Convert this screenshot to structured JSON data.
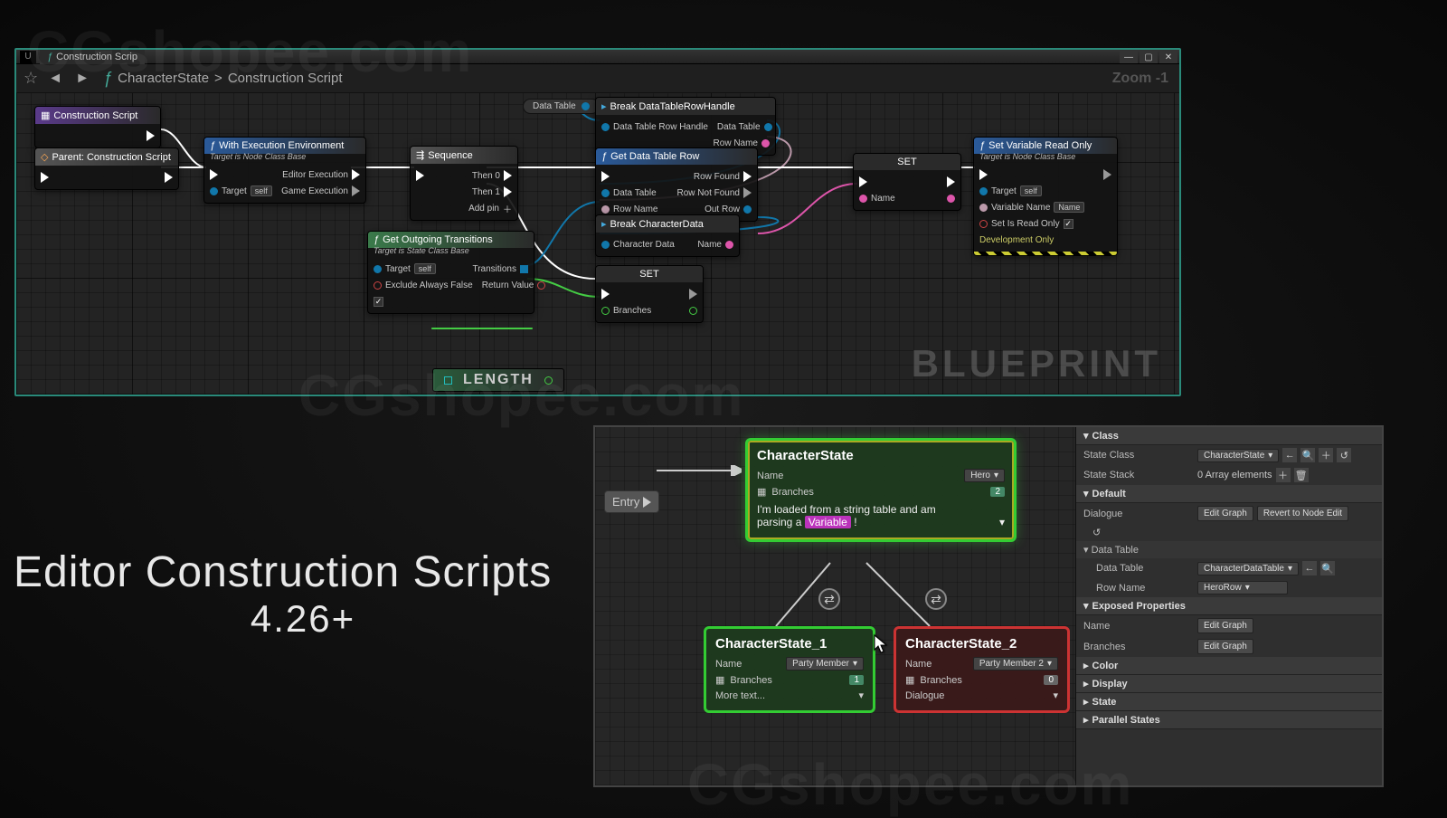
{
  "watermarks": [
    "CGshopee.com",
    "CGshopee.com",
    "CGshopee.com"
  ],
  "bp": {
    "tab_title": "Construction Scrip",
    "breadcrumb_graph": "CharacterState",
    "breadcrumb_sep": ">",
    "breadcrumb_func": "Construction Script",
    "zoom": "Zoom -1",
    "label": "BLUEPRINT",
    "nodes": {
      "cs_entry": "Construction Script",
      "parent": "Parent: Construction Script",
      "wee_title": "With Execution Environment",
      "wee_sub": "Target is Node Class Base",
      "wee_p1": "Editor Execution",
      "wee_p2": "Target",
      "wee_self": "self",
      "wee_p3": "Game Execution",
      "seq_title": "Sequence",
      "seq_then0": "Then 0",
      "seq_then1": "Then 1",
      "seq_add": "Add pin",
      "got_title": "Get Outgoing Transitions",
      "got_sub": "Target is State Class Base",
      "got_target": "Target",
      "got_self": "self",
      "got_exclude": "Exclude Always False",
      "got_trans": "Transitions",
      "got_ret": "Return Value",
      "length": "LENGTH",
      "dt_pill": "Data Table",
      "break_h": "Break DataTableRowHandle",
      "break_h_p1": "Data Table Row Handle",
      "break_h_p2": "Data Table",
      "break_h_p3": "Row Name",
      "gdt_title": "Get Data Table Row",
      "gdt_p1": "Data Table",
      "gdt_p2": "Row Name",
      "gdt_rf": "Row Found",
      "gdt_rnf": "Row Not Found",
      "gdt_out": "Out Row",
      "bcd_title": "Break CharacterData",
      "bcd_p1": "Character Data",
      "bcd_name": "Name",
      "set1": "SET",
      "set1_branches": "Branches",
      "set2": "SET",
      "set2_name": "Name",
      "svr_title": "Set Variable Read Only",
      "svr_sub": "Target is Node Class Base",
      "svr_target": "Target",
      "svr_self": "self",
      "svr_var": "Variable Name",
      "svr_name": "Name",
      "svr_ro": "Set Is Read Only",
      "svr_dev": "Development Only"
    }
  },
  "headline": {
    "line1": "Editor Construction Scripts",
    "line2": "4.26+"
  },
  "sg": {
    "entry": "Entry",
    "cs": {
      "title": "CharacterState",
      "name_lbl": "Name",
      "name_val": "Hero",
      "branches_lbl": "Branches",
      "branches_ct": "2",
      "dlg_a": "I'm loaded from a string table and am",
      "dlg_b": "parsing a",
      "var": "Variable",
      "excl": "!"
    },
    "cs1": {
      "title": "CharacterState_1",
      "name_lbl": "Name",
      "name_val": "Party Member",
      "branches_lbl": "Branches",
      "branches_ct": "1",
      "more": "More text..."
    },
    "cs2": {
      "title": "CharacterState_2",
      "name_lbl": "Name",
      "name_val": "Party Member 2",
      "branches_lbl": "Branches",
      "branches_ct": "0",
      "dlg": "Dialogue"
    }
  },
  "panel": {
    "cat_class": "Class",
    "state_class_lbl": "State Class",
    "state_class_val": "CharacterState",
    "state_stack_lbl": "State Stack",
    "state_stack_val": "0 Array elements",
    "cat_default": "Default",
    "dialogue_lbl": "Dialogue",
    "edit_graph": "Edit Graph",
    "revert": "Revert to Node Edit",
    "dt_hdr": "Data Table",
    "dt_lbl": "Data Table",
    "dt_val": "CharacterDataTable",
    "row_lbl": "Row Name",
    "row_val": "HeroRow",
    "cat_exposed": "Exposed Properties",
    "name_lbl": "Name",
    "branches_lbl": "Branches",
    "cat_color": "Color",
    "cat_display": "Display",
    "cat_state": "State",
    "cat_parallel": "Parallel States"
  }
}
